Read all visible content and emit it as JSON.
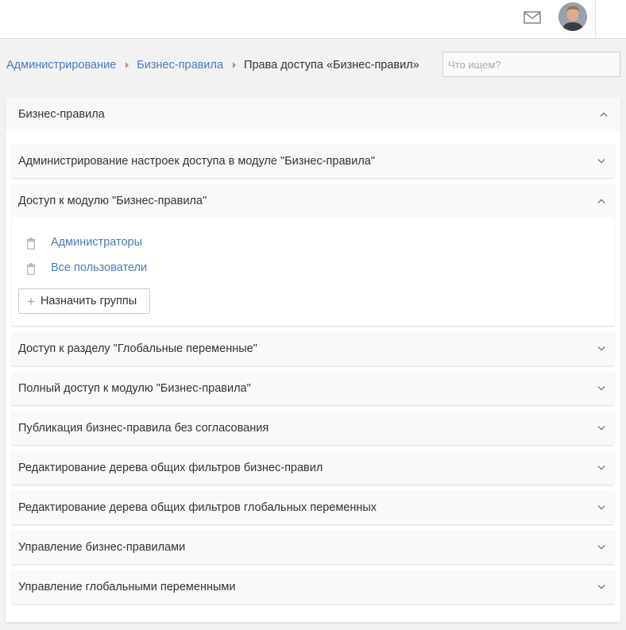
{
  "breadcrumb": {
    "items": [
      "Администрирование",
      "Бизнес-правила"
    ],
    "current": "Права доступа «Бизнес-правил»"
  },
  "search": {
    "placeholder": "Что ищем?",
    "value": ""
  },
  "section": {
    "title": "Бизнес-правила",
    "expanded": true
  },
  "permissions": [
    {
      "label": "Администрирование настроек доступа в модуле \"Бизнес-правила\"",
      "expanded": false
    },
    {
      "label": "Доступ к модулю \"Бизнес-правила\"",
      "expanded": true
    },
    {
      "label": "Доступ к разделу \"Глобальные переменные\"",
      "expanded": false
    },
    {
      "label": "Полный доступ к модулю \"Бизнес-правила\"",
      "expanded": false
    },
    {
      "label": "Публикация бизнес-правила без согласования",
      "expanded": false
    },
    {
      "label": "Редактирование дерева общих фильтров бизнес-правил",
      "expanded": false
    },
    {
      "label": "Редактирование дерева общих фильтров глобальных переменных",
      "expanded": false
    },
    {
      "label": "Управление бизнес-правилами",
      "expanded": false
    },
    {
      "label": "Управление глобальными переменными",
      "expanded": false
    }
  ],
  "expanded_groups": [
    "Администраторы",
    "Все пользователи"
  ],
  "assign_button_label": "Назначить группы",
  "icons": {
    "mail": "mail-icon",
    "trash": "trash-icon",
    "chevron_up": "chevron-up-icon",
    "chevron_down": "chevron-down-icon",
    "plus": "plus-icon"
  },
  "colors": {
    "link": "#4a7ab8",
    "text": "#333333",
    "background": "#f2f2f2"
  }
}
